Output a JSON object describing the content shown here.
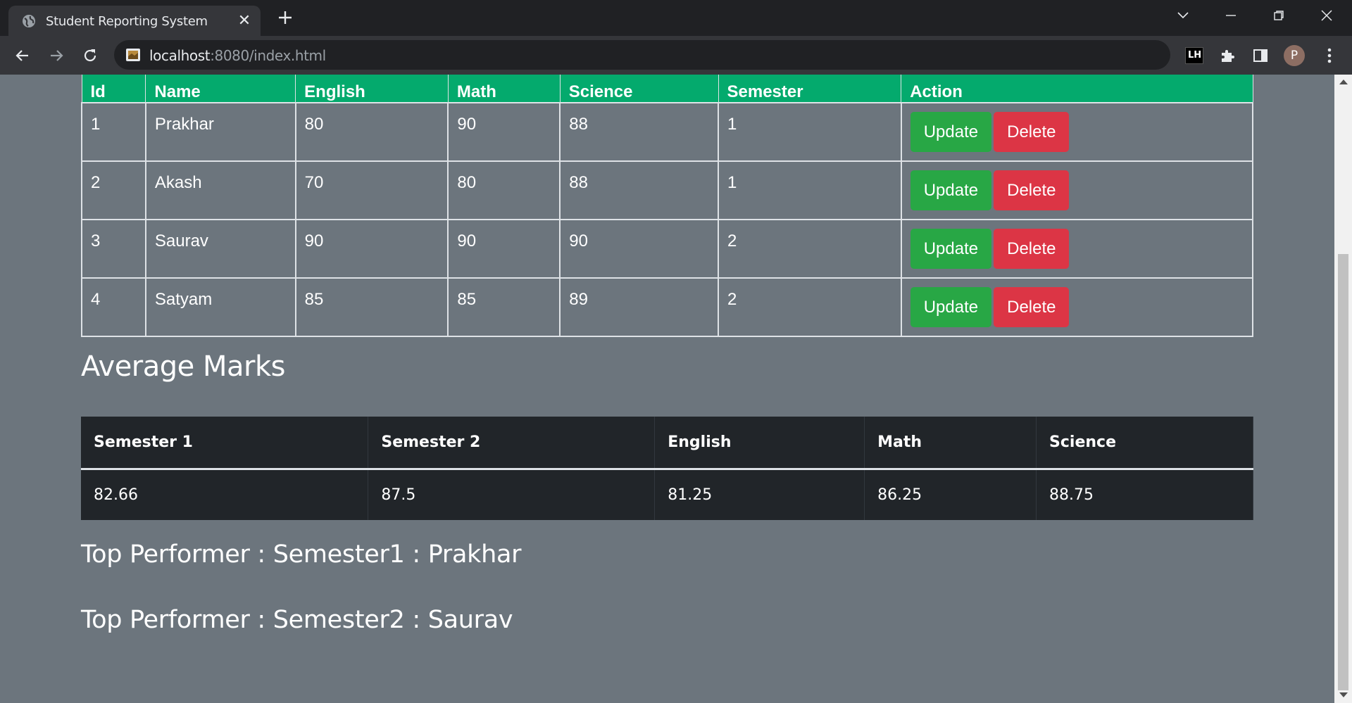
{
  "browser": {
    "tab_title": "Student Reporting System",
    "url_host": "localhost",
    "url_rest": ":8080/index.html",
    "extension_label": "LH",
    "profile_initial": "P"
  },
  "students_table": {
    "headers": [
      "Id",
      "Name",
      "English",
      "Math",
      "Science",
      "Semester",
      "Action"
    ],
    "rows": [
      {
        "id": "1",
        "name": "Prakhar",
        "english": "80",
        "math": "90",
        "science": "88",
        "semester": "1"
      },
      {
        "id": "2",
        "name": "Akash",
        "english": "70",
        "math": "80",
        "science": "88",
        "semester": "1"
      },
      {
        "id": "3",
        "name": "Saurav",
        "english": "90",
        "math": "90",
        "science": "90",
        "semester": "2"
      },
      {
        "id": "4",
        "name": "Satyam",
        "english": "85",
        "math": "85",
        "science": "89",
        "semester": "2"
      }
    ],
    "update_label": "Update",
    "delete_label": "Delete"
  },
  "average_heading": "Average Marks",
  "average_table": {
    "headers": [
      "Semester 1",
      "Semester 2",
      "English",
      "Math",
      "Science"
    ],
    "values": [
      "82.66",
      "87.5",
      "81.25",
      "86.25",
      "88.75"
    ]
  },
  "top_performers": [
    "Top Performer : Semester1 : Prakhar",
    "Top Performer : Semester2 : Saurav"
  ],
  "colors": {
    "page_bg": "#6c757d",
    "table_header": "#04aa6d",
    "update_btn": "#28a745",
    "delete_btn": "#dc3545",
    "dark_table": "#212529"
  }
}
